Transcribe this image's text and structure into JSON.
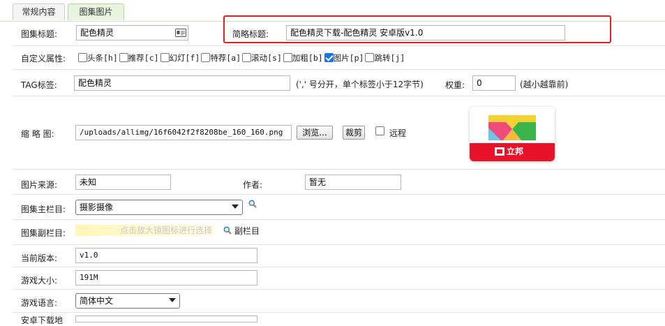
{
  "tabs": [
    {
      "label": "常规内容"
    },
    {
      "label": "图集图片"
    }
  ],
  "form": {
    "title_label": "图集标题:",
    "title_value": "配色精灵",
    "short_title_label": "简略标题:",
    "short_title_value": "配色精灵下载-配色精灵 安卓版v1.0",
    "attr_label": "自定义属性:",
    "attributes": [
      {
        "label": "头条[h]",
        "checked": false
      },
      {
        "label": "推荐[c]",
        "checked": false
      },
      {
        "label": "幻灯[f]",
        "checked": false
      },
      {
        "label": "特荐[a]",
        "checked": false
      },
      {
        "label": "滚动[s]",
        "checked": false
      },
      {
        "label": "加粗[b]",
        "checked": false
      },
      {
        "label": "图片[p]",
        "checked": true
      },
      {
        "label": "跳转[j]",
        "checked": false
      }
    ],
    "tag_label": "TAG标签:",
    "tag_value": "配色精灵",
    "tag_hint": "(',' 号分开，单个标签小于12字节)",
    "weight_label": "权重:",
    "weight_value": "0",
    "weight_hint": "(越小越靠前)",
    "thumb_label": "缩 略 图:",
    "thumb_value": "/uploads/allimg/16f6042f2f8208be_160_160.png",
    "browse_button": "浏览...",
    "crop_button": "裁剪",
    "remote_label": "远程",
    "preview_brand": "立邦",
    "source_label": "图片来源:",
    "source_value": "未知",
    "author_label": "作者:",
    "author_value": "暂无",
    "main_column_label": "图集主栏目:",
    "main_column_value": "摄影摄像",
    "sub_column_label": "图集副栏目:",
    "sub_column_placeholder": "点击放大镜图标进行选择",
    "sub_column_link": "副栏目",
    "version_label": "当前版本:",
    "version_value": "v1.0",
    "size_label": "游戏大小:",
    "size_value": "191M",
    "language_label": "游戏语言:",
    "language_value": "简体中文",
    "android_label": "安卓下载地"
  },
  "colors": {
    "highlight_box": "#e02020",
    "active_tab_bg": "#e9f4df"
  }
}
